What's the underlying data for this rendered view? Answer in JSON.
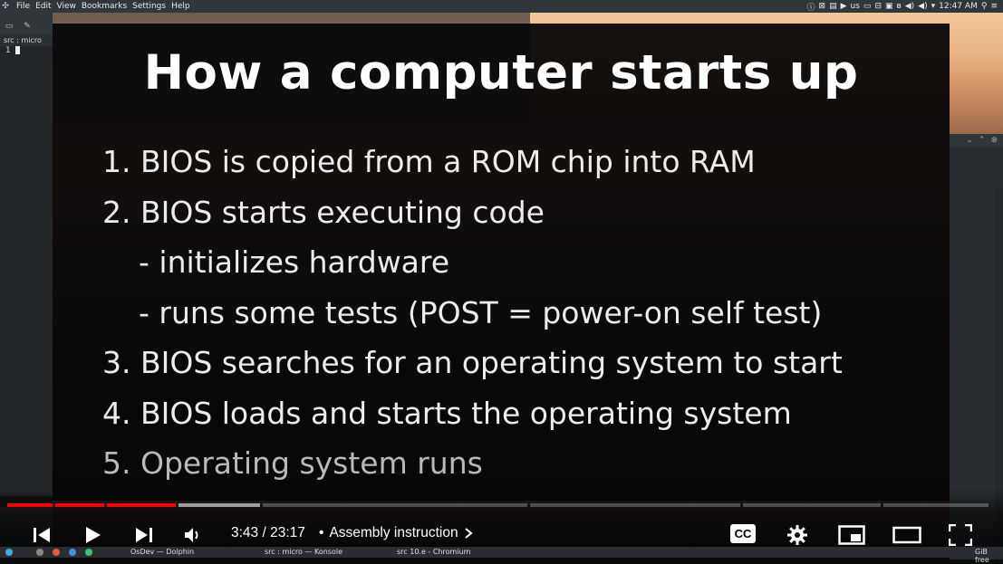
{
  "menubar": {
    "items": [
      "File",
      "Edit",
      "View",
      "Bookmarks",
      "Settings",
      "Help"
    ],
    "layout_label": "us",
    "clock": "12:47 AM"
  },
  "terminal": {
    "tab_title": "src : micro",
    "line_number": "1"
  },
  "slide": {
    "title": "How a computer starts up",
    "items": [
      "1. BIOS is copied from a ROM chip into RAM",
      "2. BIOS starts executing code",
      "- initializes hardware",
      "- runs some tests (POST = power-on self test)",
      "3. BIOS searches for an operating system to start",
      "4. BIOS loads and starts the operating system",
      "5. Operating system runs"
    ]
  },
  "player": {
    "current_time": "3:43",
    "separator": "/",
    "duration": "23:17",
    "chapter_bullet": "•",
    "chapter_title": "Assembly instruction",
    "cc_label": "CC",
    "progress_fraction": 0.16
  },
  "taskbar": {
    "tasks": [
      "OsDev — Dolphin",
      "src : micro — Konsole",
      "src 10.e - Chromium"
    ],
    "tray_text": "GiB free"
  },
  "colors": {
    "accent": "#ff0000",
    "menubar_bg": "#31363b"
  }
}
